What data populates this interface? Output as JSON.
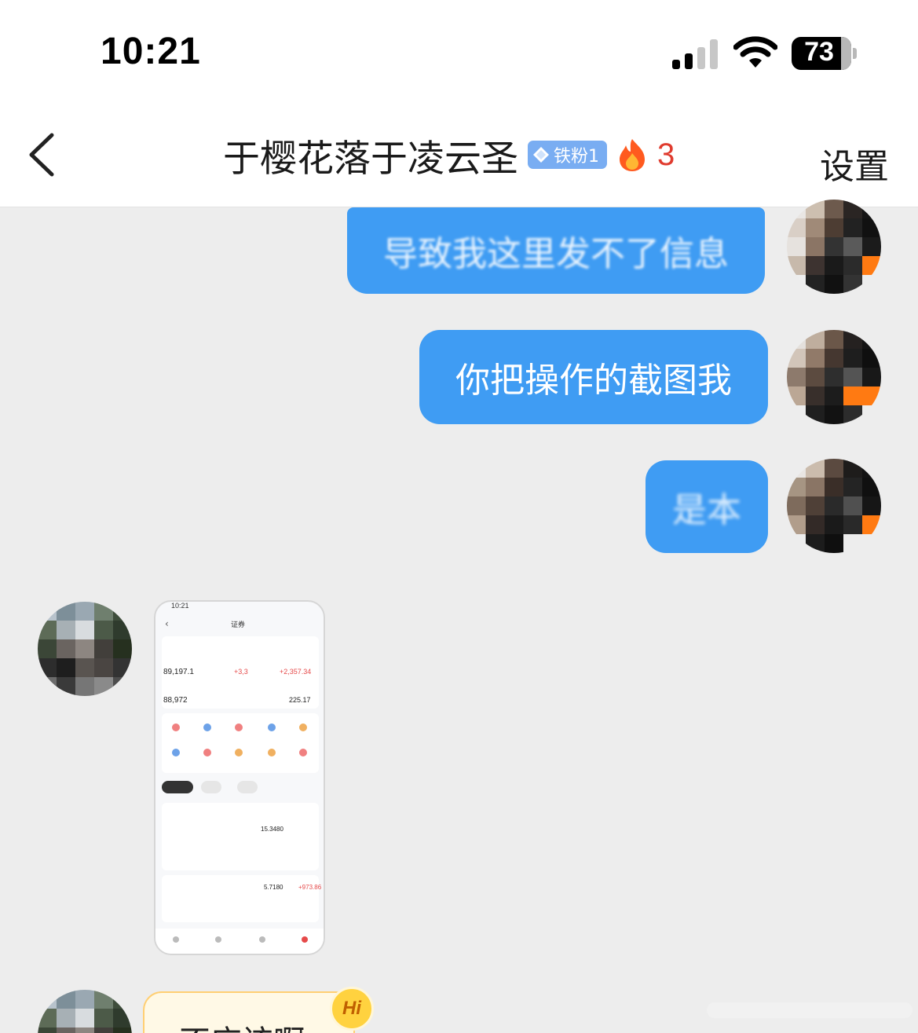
{
  "status_bar": {
    "time": "10:21",
    "battery": "73",
    "signal_bars_active": 2,
    "icons": [
      "cellular-signal-icon",
      "wifi-icon",
      "battery-icon"
    ]
  },
  "header": {
    "back_icon": "chevron-left-icon",
    "title": "于樱花落于凌云圣",
    "fan_badge": "铁粉1",
    "fire_icon": "flame-icon",
    "fire_count": "3",
    "settings_label": "设置"
  },
  "messages": [
    {
      "side": "right",
      "type": "text",
      "text": "导致我这里发不了信息",
      "note_visible": "partially obscured"
    },
    {
      "side": "right",
      "type": "text",
      "text": "你把操作的截图我"
    },
    {
      "side": "right",
      "type": "text",
      "text": "是本"
    },
    {
      "side": "left",
      "type": "image",
      "content": "trading-app-screenshot"
    },
    {
      "side": "left",
      "type": "text",
      "text": "不应该啊",
      "badge": "Hi"
    }
  ],
  "screenshot_thumbnail": {
    "time": "10:21",
    "title": "证券",
    "values": [
      "89,197.1",
      "+3,3",
      "+2,357.34",
      "88,972",
      "225.17",
      "15.3480",
      "5.7180",
      "+973.86"
    ]
  },
  "colors": {
    "bubble_blue": "#3f9cf3",
    "background": "#ededed",
    "fire_count": "#e03b2e",
    "fan_badge": "#79adf2",
    "hi_badge": "#ffd23f"
  }
}
